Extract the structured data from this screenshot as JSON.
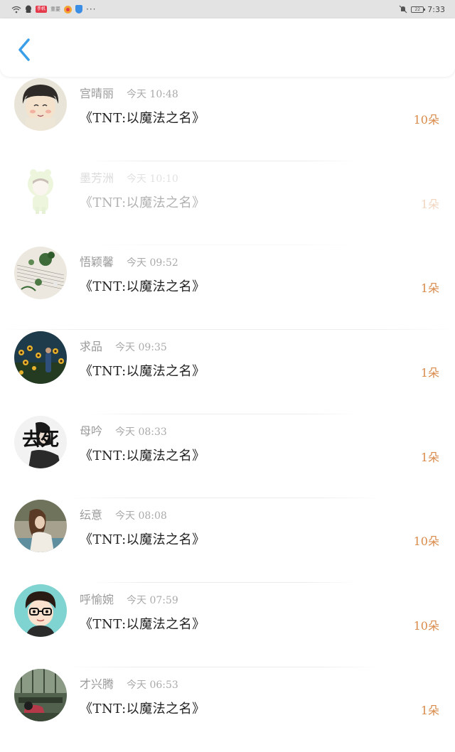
{
  "statusbar": {
    "badge": "手机",
    "app_text": "重要",
    "dots": "···",
    "battery": "22",
    "time": "7:33"
  },
  "header": {
    "back_icon": "chevron-left-icon",
    "accent_color": "#3a9fe8"
  },
  "colors": {
    "count": "#d98a4a",
    "name": "#9a9a9a",
    "title": "#222222"
  },
  "items": [
    {
      "name": "宫晴丽",
      "time": "今天 10:48",
      "title": "《TNT:以魔法之名》",
      "count": "10朵"
    },
    {
      "name": "墨芳洲",
      "time": "今天 10:10",
      "title": "《TNT:以魔法之名》",
      "count": "1朵"
    },
    {
      "name": "悟颖馨",
      "time": "今天 09:52",
      "title": "《TNT:以魔法之名》",
      "count": "1朵"
    },
    {
      "name": "求品",
      "time": "今天 09:35",
      "title": "《TNT:以魔法之名》",
      "count": "1朵"
    },
    {
      "name": "母吟",
      "time": "今天 08:33",
      "title": "《TNT:以魔法之名》",
      "count": "1朵",
      "avatar_text": "去死"
    },
    {
      "name": "纭意",
      "time": "今天 08:08",
      "title": "《TNT:以魔法之名》",
      "count": "10朵"
    },
    {
      "name": "呼愉婉",
      "time": "今天 07:59",
      "title": "《TNT:以魔法之名》",
      "count": "10朵"
    },
    {
      "name": "才兴腾",
      "time": "今天 06:53",
      "title": "《TNT:以魔法之名》",
      "count": "1朵"
    }
  ]
}
